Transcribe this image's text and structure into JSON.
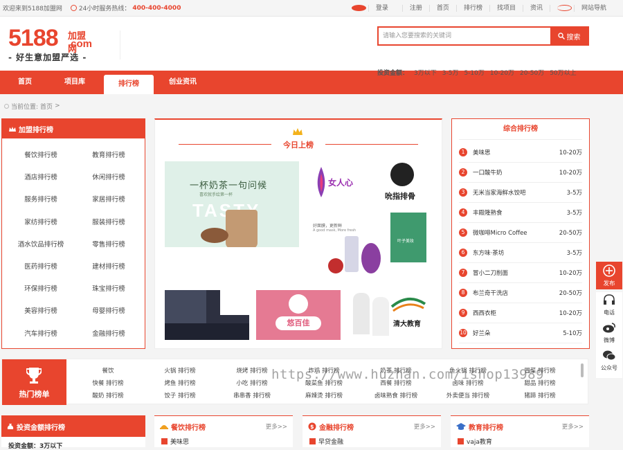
{
  "topbar": {
    "welcome": "欢迎来到5188加盟网",
    "hotline_label": "24小时服务热线：",
    "hotline": "400-400-4000",
    "links": [
      "登录",
      "注册",
      "首页",
      "排行榜",
      "找项目",
      "资讯",
      "网站导航"
    ]
  },
  "header": {
    "logo_main": "5188",
    "logo_jm": "加盟网",
    "logo_com": ".com",
    "slogan": "- 好生意加盟严选 -",
    "search_placeholder": "请输入您要搜索的关键词",
    "search_btn": "搜索",
    "invest_label": "投资金额：",
    "invest_options": [
      "3万以下",
      "3-5万",
      "5-10万",
      "10-20万",
      "20-50万",
      "50万以上"
    ]
  },
  "nav": [
    "首页",
    "项目库",
    "排行榜",
    "创业资讯"
  ],
  "crumb": {
    "label": "当前位置:",
    "home": "首页",
    "sep": ">"
  },
  "left": {
    "title": "加盟排行榜",
    "col1": [
      "餐饮排行榜",
      "酒店排行榜",
      "服务排行榜",
      "家纺排行榜",
      "酒水饮品排行榜",
      "医药排行榜",
      "环保排行榜",
      "美容排行榜",
      "汽车排行榜"
    ],
    "col2": [
      "教育排行榜",
      "休闲排行榜",
      "家居排行榜",
      "服装排行榜",
      "零售排行榜",
      "建材排行榜",
      "珠宝排行榜",
      "母婴排行榜",
      "金融排行榜"
    ]
  },
  "today": {
    "title": "今日上榜",
    "tea_line1": "一杯奶茶一句问候",
    "tea_sub": "喜欢就手绘第一杯",
    "tasty": "TASTY",
    "nvxin": "女人心",
    "shop_caption": "吮指排骨",
    "mask_caption": "好面膜，更新鲜",
    "mask_en": "A good mask, More fresh",
    "brand_r": "叶子美妆",
    "pink_brand": "悠百佳",
    "edu_brand": "清大教育"
  },
  "ranking": {
    "title": "综合排行榜",
    "rows": [
      {
        "n": "1",
        "name": "美味思",
        "price": "10-20万"
      },
      {
        "n": "2",
        "name": "一口酸牛奶",
        "price": "10-20万"
      },
      {
        "n": "3",
        "name": "无米当家海鲜水饺吧",
        "price": "3-5万"
      },
      {
        "n": "4",
        "name": "丰殿隆熟食",
        "price": "3-5万"
      },
      {
        "n": "5",
        "name": "微咖啡Micro Coffee",
        "price": "20-50万"
      },
      {
        "n": "6",
        "name": "东方味·茶坊",
        "price": "3-5万"
      },
      {
        "n": "7",
        "name": "冒小二刀削面",
        "price": "10-20万"
      },
      {
        "n": "8",
        "name": "布兰奇干洗店",
        "price": "20-50万"
      },
      {
        "n": "9",
        "name": "西西衣柜",
        "price": "10-20万"
      },
      {
        "n": "10",
        "name": "好兰朵",
        "price": "5-10万"
      }
    ]
  },
  "hot": {
    "title": "热门榜单",
    "cells": [
      [
        "餐饮",
        "火锅 排行榜",
        "烧烤 排行榜",
        "炸鸡 排行榜",
        "奶茶 排行榜",
        "鱼火锅 排行榜",
        "冒菜 排行榜"
      ],
      [
        "快餐 排行榜",
        "烤鱼 排行榜",
        "小吃 排行榜",
        "酸菜鱼 排行榜",
        "西餐 排行榜",
        "卤味 排行榜",
        "甜品 排行榜"
      ],
      [
        "酸奶 排行榜",
        "饺子 排行榜",
        "串串香 排行榜",
        "麻辣烫 排行榜",
        "卤味熟食 排行榜",
        "外卖便当 排行榜",
        "猪蹄 排行榜"
      ]
    ]
  },
  "side": {
    "publish": "发布",
    "phone": "电话",
    "weibo": "微博",
    "wechat": "公众号"
  },
  "bottom": {
    "invest_title": "投资金额排行榜",
    "invest_first": "投资金额：3万以下",
    "food_title": "餐饮排行榜",
    "fin_title": "金融排行榜",
    "edu_title": "教育排行榜",
    "more": "更多>>",
    "food_first": "美味思",
    "fin_first": "早贷金融",
    "edu_first": "vaja教育"
  },
  "watermark": "https://www.huzhan.com/ishop13989",
  "colors": {
    "accent": "#e8452e"
  }
}
